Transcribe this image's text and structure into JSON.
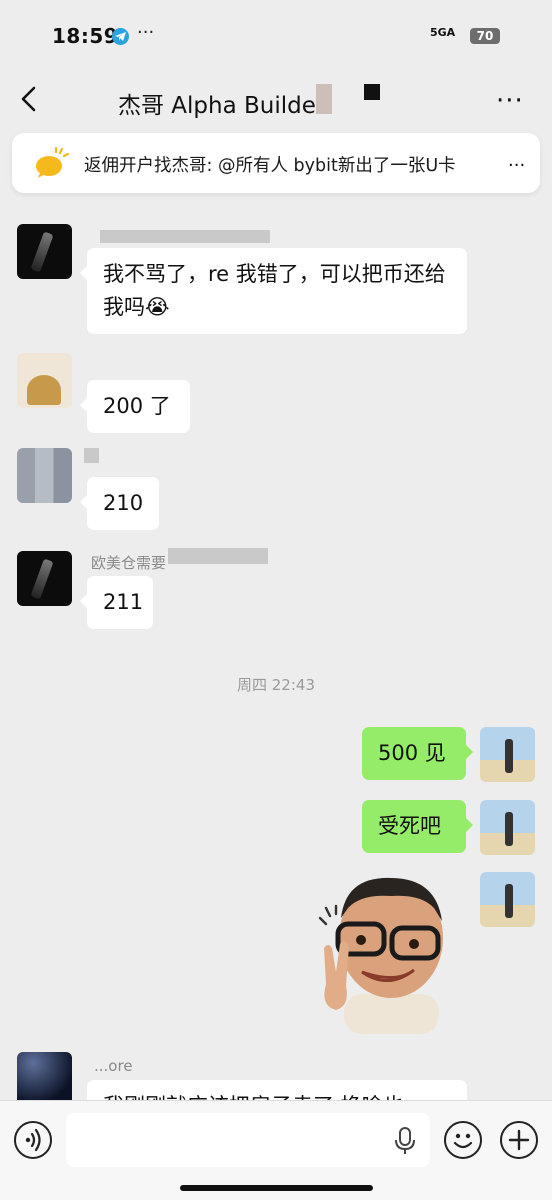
{
  "status": {
    "time": "18:59",
    "network": "5GA",
    "battery": "70",
    "more": "···"
  },
  "nav": {
    "title": "杰哥 Alpha Builder",
    "more": "···"
  },
  "announcement": {
    "text": "返佣开户找杰哥: @所有人 bybit新出了一张U卡",
    "more": "..."
  },
  "messages": [
    {
      "side": "left",
      "text": "我不骂了，re 我错了，可以把币还给我吗😭"
    },
    {
      "side": "left",
      "text": "200 了"
    },
    {
      "side": "left",
      "text": "210"
    },
    {
      "side": "left",
      "sender": "欧美仓需要",
      "text": "211"
    },
    {
      "side": "right",
      "text": "500 见"
    },
    {
      "side": "right",
      "text": "受死吧"
    },
    {
      "side": "left",
      "sender": "...ore",
      "text": "我刚刚就应该把房子卖了 换啥也"
    }
  ],
  "time_separator": "周四 22:43",
  "colors": {
    "background": "#ededed",
    "bubble_self": "#95ec69",
    "bubble_other": "#ffffff"
  }
}
